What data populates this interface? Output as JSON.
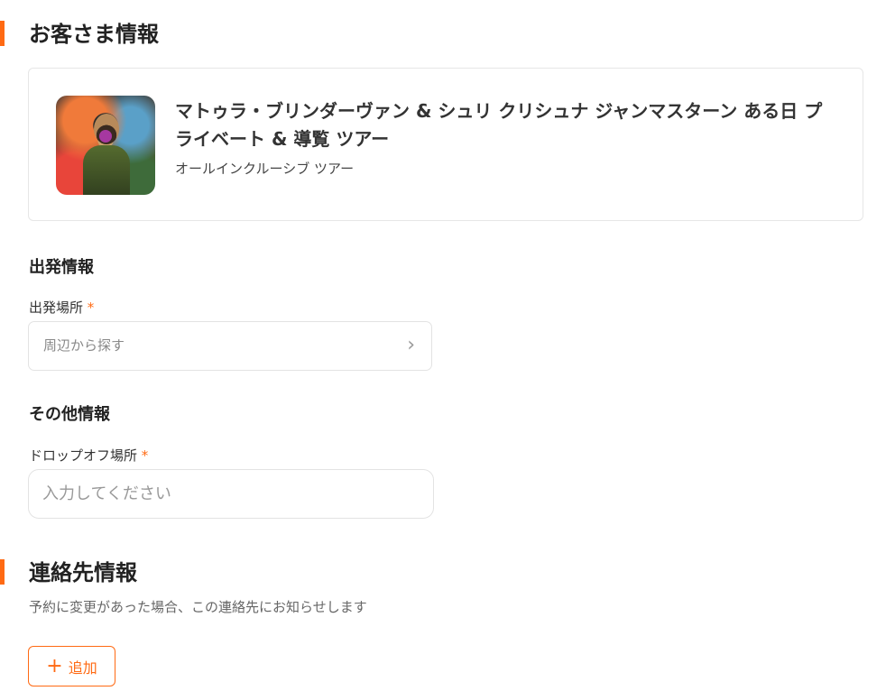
{
  "customer_section": {
    "title": "お客さま情報",
    "product": {
      "title": "マトゥラ・ブリンダーヴァン & シュリ クリシュナ ジャンマスターン ある日 プライベート & 導覧 ツアー",
      "subtitle": "オールインクルーシブ ツアー"
    },
    "departure": {
      "heading": "出発情報",
      "label": "出発場所",
      "required_mark": "*",
      "placeholder": "周辺から探す",
      "chevron_icon": "chevron-right-icon"
    },
    "other": {
      "heading": "その他情報",
      "label": "ドロップオフ場所",
      "required_mark": "*",
      "placeholder": "入力してください"
    }
  },
  "contact_section": {
    "title": "連絡先情報",
    "description": "予約に変更があった場合、この連絡先にお知らせします",
    "add_button": {
      "icon": "plus-icon",
      "label": "追加"
    }
  },
  "colors": {
    "accent": "#ff6a13",
    "border": "#e3e3e3"
  }
}
